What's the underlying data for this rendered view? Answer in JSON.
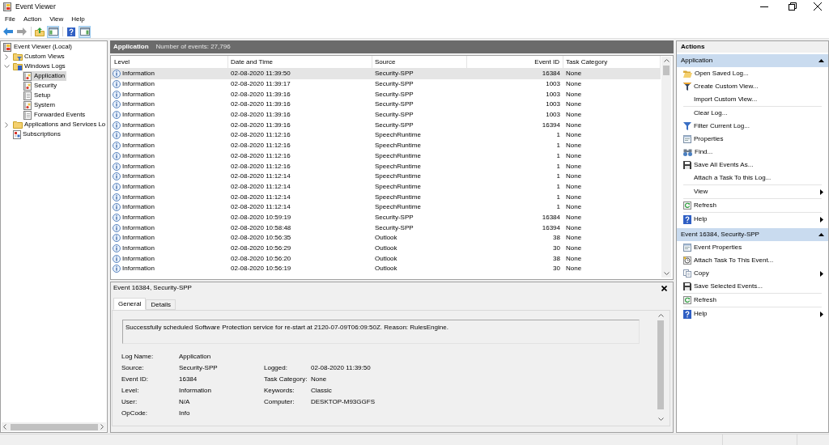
{
  "window": {
    "title": "Event Viewer"
  },
  "menu": [
    "File",
    "Action",
    "View",
    "Help"
  ],
  "toolbar": [
    {
      "disabled": false,
      "pressed": false
    },
    {
      "disabled": true,
      "pressed": false
    },
    {
      "disabled": false,
      "pressed": false
    },
    {
      "disabled": false,
      "pressed": true
    },
    {
      "disabled": false,
      "pressed": false
    },
    {
      "disabled": false,
      "pressed": true
    }
  ],
  "tree": [
    {
      "label": "Event Viewer (Local)",
      "selected": false,
      "children": [
        {
          "label": "Custom Views",
          "selected": false,
          "expanded": false
        },
        {
          "label": "Windows Logs",
          "selected": false,
          "expanded": true,
          "children": [
            {
              "label": "Application",
              "selected": true
            },
            {
              "label": "Security",
              "selected": false
            },
            {
              "label": "Setup",
              "selected": false
            },
            {
              "label": "System",
              "selected": false
            },
            {
              "label": "Forwarded Events",
              "selected": false
            }
          ]
        },
        {
          "label": "Applications and Services Lo",
          "selected": false,
          "expanded": false
        },
        {
          "label": "Subscriptions",
          "selected": false
        }
      ]
    }
  ],
  "log_header": {
    "title": "Application",
    "count": "Number of events: 27,796"
  },
  "table": {
    "columns": [
      "Level",
      "Date and Time",
      "Source",
      "Event ID",
      "Task Category"
    ],
    "rows": [
      {
        "level": "Information",
        "date_time": "02-08-2020 11:39:50",
        "source": "Security-SPP",
        "event_id": "16384",
        "task_category": "None",
        "selected": true
      },
      {
        "level": "Information",
        "date_time": "02-08-2020 11:39:17",
        "source": "Security-SPP",
        "event_id": "1003",
        "task_category": "None",
        "selected": false
      },
      {
        "level": "Information",
        "date_time": "02-08-2020 11:39:16",
        "source": "Security-SPP",
        "event_id": "1003",
        "task_category": "None",
        "selected": false
      },
      {
        "level": "Information",
        "date_time": "02-08-2020 11:39:16",
        "source": "Security-SPP",
        "event_id": "1003",
        "task_category": "None",
        "selected": false
      },
      {
        "level": "Information",
        "date_time": "02-08-2020 11:39:16",
        "source": "Security-SPP",
        "event_id": "1003",
        "task_category": "None",
        "selected": false
      },
      {
        "level": "Information",
        "date_time": "02-08-2020 11:39:16",
        "source": "Security-SPP",
        "event_id": "16394",
        "task_category": "None",
        "selected": false
      },
      {
        "level": "Information",
        "date_time": "02-08-2020 11:12:16",
        "source": "SpeechRuntime",
        "event_id": "1",
        "task_category": "None",
        "selected": false
      },
      {
        "level": "Information",
        "date_time": "02-08-2020 11:12:16",
        "source": "SpeechRuntime",
        "event_id": "1",
        "task_category": "None",
        "selected": false
      },
      {
        "level": "Information",
        "date_time": "02-08-2020 11:12:16",
        "source": "SpeechRuntime",
        "event_id": "1",
        "task_category": "None",
        "selected": false
      },
      {
        "level": "Information",
        "date_time": "02-08-2020 11:12:16",
        "source": "SpeechRuntime",
        "event_id": "1",
        "task_category": "None",
        "selected": false
      },
      {
        "level": "Information",
        "date_time": "02-08-2020 11:12:14",
        "source": "SpeechRuntime",
        "event_id": "1",
        "task_category": "None",
        "selected": false
      },
      {
        "level": "Information",
        "date_time": "02-08-2020 11:12:14",
        "source": "SpeechRuntime",
        "event_id": "1",
        "task_category": "None",
        "selected": false
      },
      {
        "level": "Information",
        "date_time": "02-08-2020 11:12:14",
        "source": "SpeechRuntime",
        "event_id": "1",
        "task_category": "None",
        "selected": false
      },
      {
        "level": "Information",
        "date_time": "02-08-2020 11:12:14",
        "source": "SpeechRuntime",
        "event_id": "1",
        "task_category": "None",
        "selected": false
      },
      {
        "level": "Information",
        "date_time": "02-08-2020 10:59:19",
        "source": "Security-SPP",
        "event_id": "16384",
        "task_category": "None",
        "selected": false
      },
      {
        "level": "Information",
        "date_time": "02-08-2020 10:58:48",
        "source": "Security-SPP",
        "event_id": "16394",
        "task_category": "None",
        "selected": false
      },
      {
        "level": "Information",
        "date_time": "02-08-2020 10:56:35",
        "source": "Outlook",
        "event_id": "38",
        "task_category": "None",
        "selected": false
      },
      {
        "level": "Information",
        "date_time": "02-08-2020 10:56:29",
        "source": "Outlook",
        "event_id": "30",
        "task_category": "None",
        "selected": false
      },
      {
        "level": "Information",
        "date_time": "02-08-2020 10:56:20",
        "source": "Outlook",
        "event_id": "38",
        "task_category": "None",
        "selected": false
      },
      {
        "level": "Information",
        "date_time": "02-08-2020 10:56:19",
        "source": "Outlook",
        "event_id": "30",
        "task_category": "None",
        "selected": false
      }
    ]
  },
  "details": {
    "title": "Event 16384, Security-SPP",
    "tabs": [
      {
        "label": "General",
        "selected": true
      },
      {
        "label": "Details",
        "selected": false
      }
    ],
    "message": "Successfully scheduled Software Protection service for re-start at 2120-07-09T06:09:50Z. Reason: RulesEngine.",
    "rows": [
      {
        "left": {
          "label": "Log Name:",
          "value": "Application"
        }
      },
      {
        "left": {
          "label": "Source:",
          "value": "Security-SPP"
        },
        "right": {
          "label": "Logged:",
          "value": "02-08-2020 11:39:50"
        }
      },
      {
        "left": {
          "label": "Event ID:",
          "value": "16384"
        },
        "right": {
          "label": "Task Category:",
          "value": "None"
        }
      },
      {
        "left": {
          "label": "Level:",
          "value": "Information"
        },
        "right": {
          "label": "Keywords:",
          "value": "Classic"
        }
      },
      {
        "left": {
          "label": "User:",
          "value": "N/A"
        },
        "right": {
          "label": "Computer:",
          "value": "DESKTOP-M93GGFS"
        }
      },
      {
        "left": {
          "label": "OpCode:",
          "value": "Info"
        }
      }
    ]
  },
  "actions": {
    "title": "Actions",
    "sections": [
      {
        "title": "Application",
        "expanded": true,
        "groups": [
          [
            {
              "label": "Open Saved Log...",
              "submenu": false
            },
            {
              "label": "Create Custom View...",
              "submenu": false
            },
            {
              "label": "Import Custom View...",
              "submenu": false
            }
          ],
          [
            {
              "label": "Clear Log...",
              "submenu": false
            },
            {
              "label": "Filter Current Log...",
              "submenu": false
            },
            {
              "label": "Properties",
              "submenu": false
            },
            {
              "label": "Find...",
              "submenu": false
            },
            {
              "label": "Save All Events As...",
              "submenu": false
            },
            {
              "label": "Attach a Task To this Log...",
              "submenu": false
            }
          ],
          [
            {
              "label": "View",
              "submenu": true
            }
          ],
          [
            {
              "label": "Refresh",
              "submenu": false
            }
          ],
          [
            {
              "label": "Help",
              "submenu": true
            }
          ]
        ]
      },
      {
        "title": "Event 16384, Security-SPP",
        "expanded": true,
        "groups": [
          [
            {
              "label": "Event Properties",
              "submenu": false
            },
            {
              "label": "Attach Task To This Event...",
              "submenu": false
            },
            {
              "label": "Copy",
              "submenu": true
            },
            {
              "label": "Save Selected Events...",
              "submenu": false
            }
          ],
          [
            {
              "label": "Refresh",
              "submenu": false
            }
          ],
          [
            {
              "label": "Help",
              "submenu": true
            }
          ]
        ]
      }
    ]
  }
}
